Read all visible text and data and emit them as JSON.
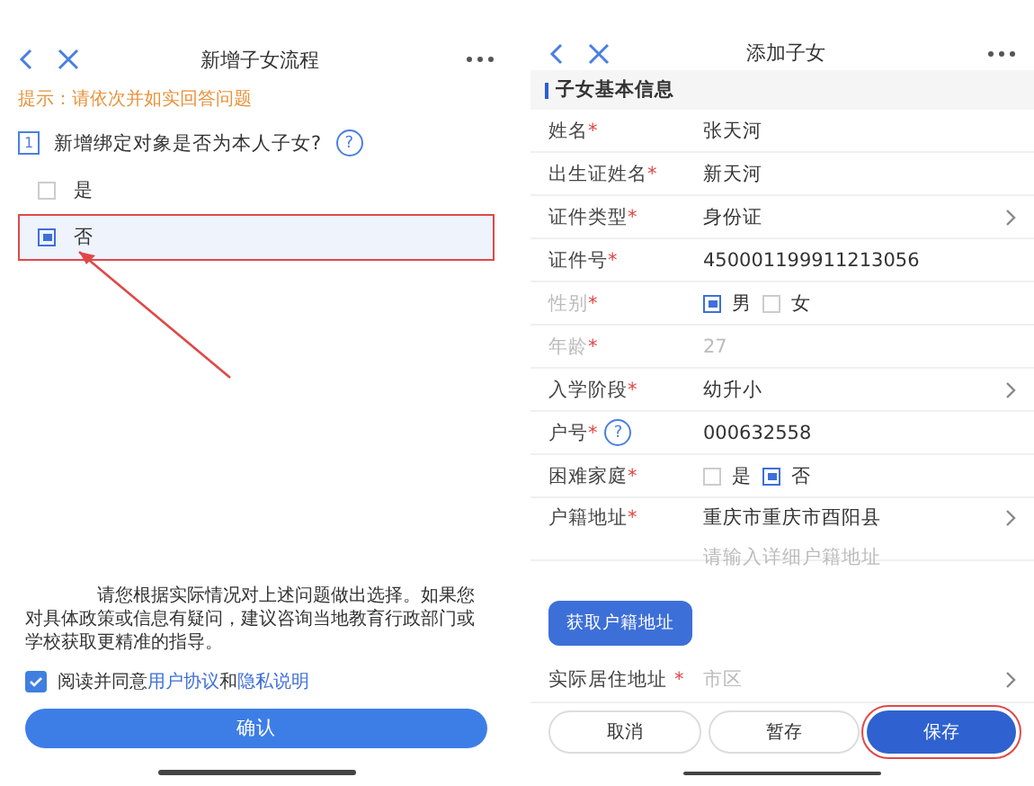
{
  "left": {
    "title": "新增子女流程",
    "hint": "提示：请依次并如实回答问题",
    "question": {
      "number": "1",
      "text": "新增绑定对象是否为本人子女?",
      "help": "?"
    },
    "options": [
      {
        "label": "是",
        "selected": false
      },
      {
        "label": "否",
        "selected": true
      }
    ],
    "notice": "请您根据实际情况对上述问题做出选择。如果您对具体政策或信息有疑问，建议咨询当地教育行政部门或学校获取更精准的指导。",
    "agree": {
      "checked": true,
      "prefix": "阅读并同意",
      "link1": "用户协议",
      "middle": "和",
      "link2": "隐私说明"
    },
    "confirm": "确认"
  },
  "right": {
    "title": "添加子女",
    "section": "子女基本信息",
    "rows": [
      {
        "kind": "text",
        "label": "姓名",
        "required": "*",
        "value": "张天河",
        "disabled": false
      },
      {
        "kind": "text",
        "label": "出生证姓名",
        "required": "*",
        "value": "新天河",
        "disabled": false
      },
      {
        "kind": "select",
        "label": "证件类型",
        "required": "*",
        "value": "身份证",
        "disabled": false
      },
      {
        "kind": "text",
        "label": "证件号",
        "required": "*",
        "value": "450001199911213056",
        "disabled": false
      },
      {
        "kind": "radio",
        "label": "性别",
        "required": "*",
        "disabled": true,
        "options": [
          {
            "label": "男",
            "selected": true
          },
          {
            "label": "女",
            "selected": false
          }
        ]
      },
      {
        "kind": "text",
        "label": "年龄",
        "required": "*",
        "value": "27",
        "disabled": true
      },
      {
        "kind": "select",
        "label": "入学阶段",
        "required": "*",
        "value": "幼升小",
        "disabled": false
      },
      {
        "kind": "input",
        "label": "户号",
        "required": "*",
        "help": "?",
        "value": "000632558",
        "disabled": false
      },
      {
        "kind": "radio",
        "label": "困难家庭",
        "required": "*",
        "disabled": false,
        "options": [
          {
            "label": "是",
            "selected": false
          },
          {
            "label": "否",
            "selected": true
          }
        ]
      },
      {
        "kind": "address",
        "label": "户籍地址",
        "required": "*",
        "value": "重庆市重庆市酉阳县",
        "placeholder": "请输入详细户籍地址",
        "disabled": false
      }
    ],
    "fetch_button": "获取户籍地址",
    "residence": {
      "label": "实际居住地址",
      "required": "*",
      "placeholder": "市区"
    },
    "buttons": [
      {
        "label": "取消",
        "kind": "outline",
        "highlighted": false
      },
      {
        "label": "暂存",
        "kind": "outline",
        "highlighted": false
      },
      {
        "label": "保存",
        "kind": "primary",
        "highlighted": true
      }
    ]
  }
}
